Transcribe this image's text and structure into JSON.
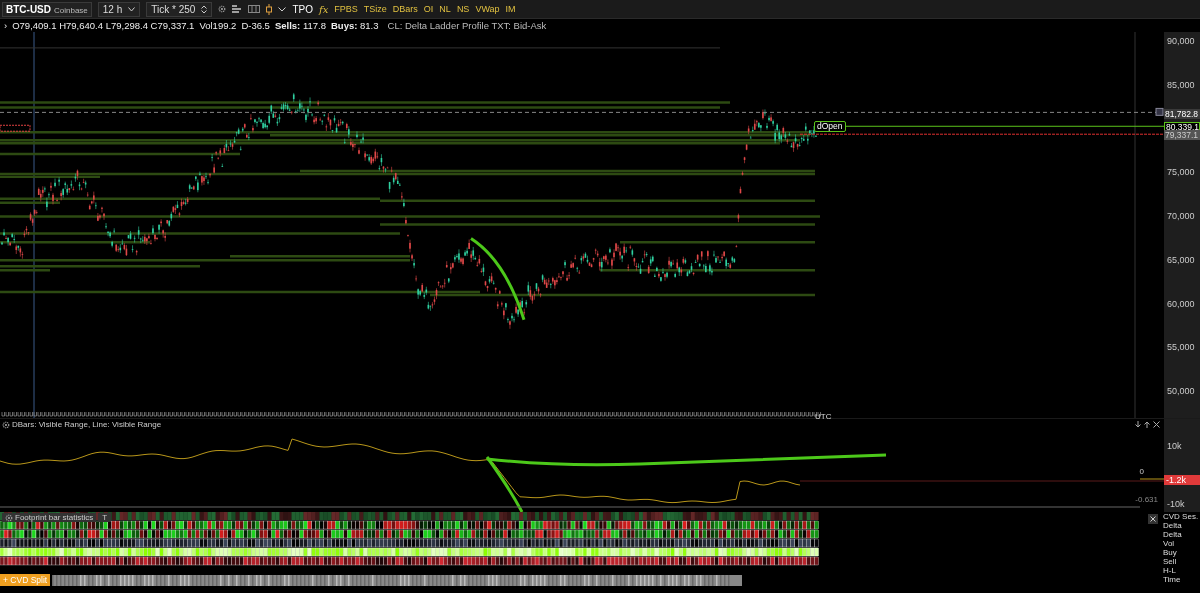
{
  "toolbar": {
    "symbol": "BTC-USD",
    "exchange": "Coinbase",
    "timeframe": "12 h",
    "chart_type": "Tick *",
    "tick_size": "250",
    "tpo": "TPO",
    "formula": "fx",
    "indicators": [
      "FPBS",
      "TSize",
      "DBars",
      "OI",
      "NL",
      "NS",
      "VWap",
      "IM"
    ]
  },
  "info_bar": {
    "expand": "›",
    "ohlc": [
      "O79,409.1",
      "H79,640.4",
      "L79,298.4",
      "C79,337.1"
    ],
    "volume": "Vol199.2",
    "delta": "D-36.5",
    "stats": [
      {
        "label": "Sells:",
        "value": "117.8"
      },
      {
        "label": "Buys:",
        "value": "81.3"
      }
    ],
    "study_note": "CL: Delta Ladder Profile TXT: Bid-Ask"
  },
  "price_chart": {
    "price_axis": [
      "90,000",
      "85,000",
      "75,000",
      "70,000",
      "65,000",
      "60,000",
      "55,000",
      "50,000"
    ],
    "markers": [
      {
        "label": "81,782.8",
        "kind": "high"
      },
      {
        "label": "80,339.1",
        "kind": "open"
      },
      {
        "label": "79,337.1",
        "kind": "last"
      }
    ],
    "open_tag": "dOpen",
    "time_zone": "UTC"
  },
  "delta_panel": {
    "title": "DBars: Visible Range, Line: Visible Range",
    "axis_top": "10k",
    "axis_bottom": "-10k",
    "zero_label": "0",
    "min_label": "-0.631",
    "last_value": "-1.2k"
  },
  "footprint": {
    "title": "Footprint bar statistics",
    "toggle": "T",
    "legend": [
      "CVD Ses.",
      "Delta",
      "Delta",
      "Vol",
      "Buy",
      "Sell",
      "H-L",
      "Time"
    ]
  },
  "cvd_split": "+ CVD Split"
}
